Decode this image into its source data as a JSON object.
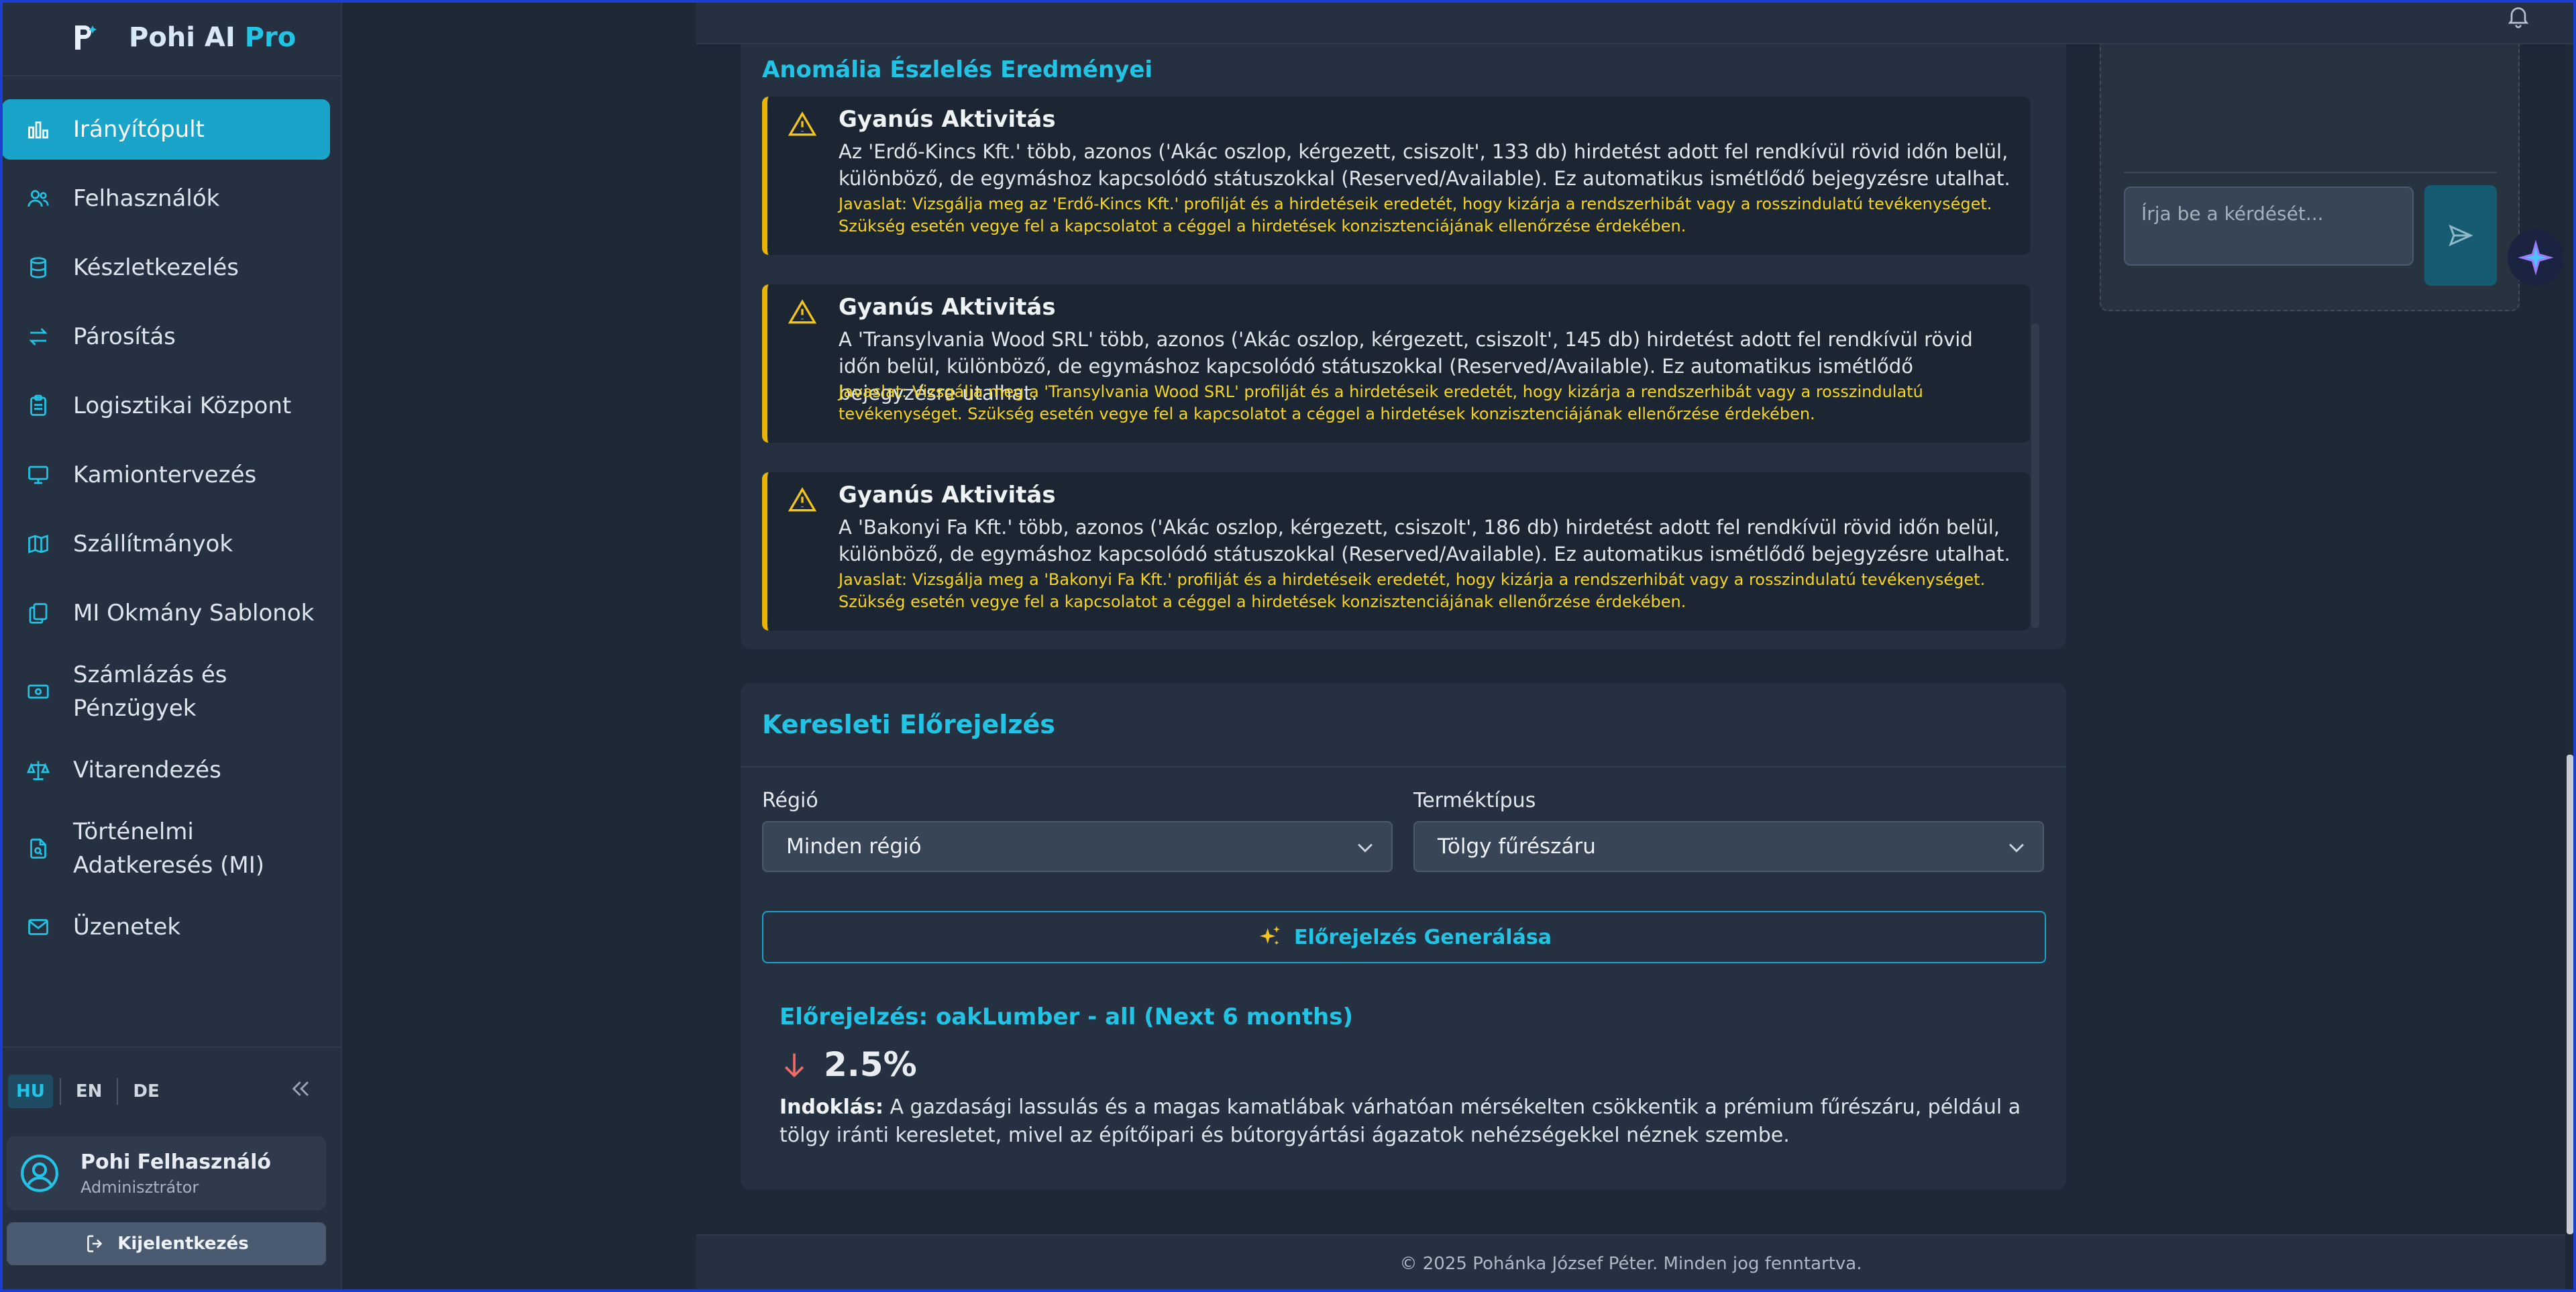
{
  "brand": {
    "name": "Pohi AI",
    "suffix": "Pro"
  },
  "nav": {
    "items": [
      {
        "label": "Irányítópult",
        "icon": "bar-chart-icon",
        "active": true
      },
      {
        "label": "Felhasználók",
        "icon": "users-icon"
      },
      {
        "label": "Készletkezelés",
        "icon": "database-icon"
      },
      {
        "label": "Párosítás",
        "icon": "arrows-swap-icon"
      },
      {
        "label": "Logisztikai Központ",
        "icon": "clipboard-icon"
      },
      {
        "label": "Kamiontervezés",
        "icon": "monitor-icon"
      },
      {
        "label": "Szállítmányok",
        "icon": "map-icon"
      },
      {
        "label": "MI Okmány Sablonok",
        "icon": "documents-icon"
      },
      {
        "label": "Számlázás és Pénzügyek",
        "icon": "banknote-icon"
      },
      {
        "label": "Vitarendezés",
        "icon": "scales-icon"
      },
      {
        "label": "Történelmi Adatkeresés (MI)",
        "icon": "file-search-icon"
      },
      {
        "label": "Üzenetek",
        "icon": "mail-icon"
      }
    ]
  },
  "languages": {
    "hu": "HU",
    "en": "EN",
    "de": "DE",
    "active": "HU"
  },
  "user": {
    "name": "Pohi Felhasználó",
    "role": "Adminisztrátor"
  },
  "logout_label": "Kijelentkezés",
  "anomaly": {
    "title": "Anomália Észlelés Eredményei",
    "alerts": [
      {
        "heading": "Gyanús Aktivitás",
        "body": "Az 'Erdő-Kincs Kft.' több, azonos ('Akác oszlop, kérgezett, csiszolt', 133 db) hirdetést adott fel rendkívül rövid időn belül, különböző, de egymáshoz kapcsolódó státuszokkal (Reserved/Available). Ez automatikus ismétlődő bejegyzésre utalhat.",
        "tip": "Javaslat: Vizsgálja meg az 'Erdő-Kincs Kft.' profilját és a hirdetéseik eredetét, hogy kizárja a rendszerhibát vagy a rosszindulatú tevékenységet. Szükség esetén vegye fel a kapcsolatot a céggel a hirdetések konzisztenciájának ellenőrzése érdekében."
      },
      {
        "heading": "Gyanús Aktivitás",
        "body": "A 'Transylvania Wood SRL' több, azonos ('Akác oszlop, kérgezett, csiszolt', 145 db) hirdetést adott fel rendkívül rövid időn belül, különböző, de egymáshoz kapcsolódó státuszokkal (Reserved/Available). Ez automatikus ismétlődő bejegyzésre utalhat.",
        "tip": "Javaslat: Vizsgálja meg a 'Transylvania Wood SRL' profilját és a hirdetéseik eredetét, hogy kizárja a rendszerhibát vagy a rosszindulatú tevékenységet. Szükség esetén vegye fel a kapcsolatot a céggel a hirdetések konzisztenciájának ellenőrzése érdekében."
      },
      {
        "heading": "Gyanús Aktivitás",
        "body": "A 'Bakonyi Fa Kft.' több, azonos ('Akác oszlop, kérgezett, csiszolt', 186 db) hirdetést adott fel rendkívül rövid időn belül, különböző, de egymáshoz kapcsolódó státuszokkal (Reserved/Available). Ez automatikus ismétlődő bejegyzésre utalhat.",
        "tip": "Javaslat: Vizsgálja meg a 'Bakonyi Fa Kft.' profilját és a hirdetéseik eredetét, hogy kizárja a rendszerhibát vagy a rosszindulatú tevékenységet. Szükség esetén vegye fel a kapcsolatot a céggel a hirdetések konzisztenciájának ellenőrzése érdekében."
      }
    ]
  },
  "chat": {
    "placeholder": "Írja be a kérdését..."
  },
  "forecast": {
    "title": "Keresleti Előrejelzés",
    "region_label": "Régió",
    "region_value": "Minden régió",
    "product_label": "Terméktípus",
    "product_value": "Tölgy fűrészáru",
    "generate_label": "Előrejelzés Generálása",
    "result_title": "Előrejelzés: oakLumber - all (Next 6 months)",
    "result_value": "2.5%",
    "trend": "down",
    "reason_label": "Indoklás:",
    "reason_text": "A gazdasági lassulás és a magas kamatlábak várhatóan mérsékelten csökkentik a prémium fűrészáru, például a tölgy iránti keresletet, mivel az építőipari és bútorgyártási ágazatok nehézségekkel néznek szembe."
  },
  "footer": "© 2025 Pohánka József Péter. Minden jog fenntartva.",
  "colors": {
    "accent": "#22c4e6",
    "active_nav": "#1aa4c9",
    "warning": "#eab308",
    "tip_text": "#f7d51d",
    "down": "#f06a6a"
  }
}
